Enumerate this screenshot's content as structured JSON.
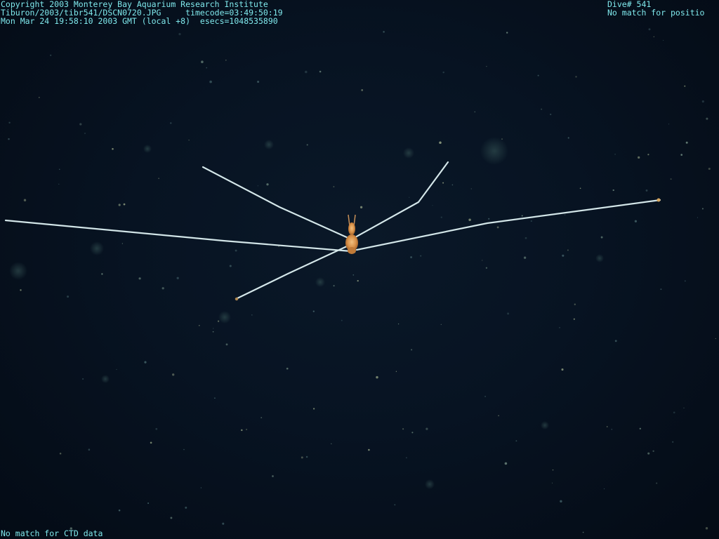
{
  "overlay": {
    "copyright": "Copyright 2003 Monterey Bay Aquarium Research Institute",
    "file_path": "Tiburon/2003/tibr541/DSCN0720.JPG",
    "timecode": "timecode=03:49:50:19",
    "datetime": "Mon Mar 24 19:58:10 2003 GMT (local +8)",
    "esecs": "esecs=1048535890",
    "dive": "Dive# 541",
    "position_status": "No match for positio",
    "ctd_status": "No match for CTD data"
  },
  "colors": {
    "overlay_text": "#7fe8ec",
    "background": "#071322",
    "body": "#e0a050",
    "legs": "#c8dde0"
  },
  "subject": "pycnogonid-sea-spider"
}
